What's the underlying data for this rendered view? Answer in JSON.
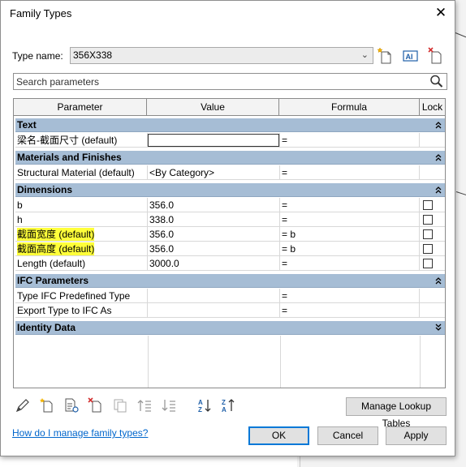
{
  "window": {
    "title": "Family Types",
    "close_symbol": "✕"
  },
  "type_name": {
    "label": "Type name:",
    "value": "356X338"
  },
  "search": {
    "placeholder": "Search parameters"
  },
  "grid": {
    "columns": [
      "Parameter",
      "Value",
      "Formula",
      "Lock"
    ],
    "groups": [
      {
        "label": "Text",
        "rows": [
          {
            "param": "梁名-截面尺寸 (default)",
            "value": "",
            "formula": "=",
            "lock": false,
            "editing": true
          }
        ]
      },
      {
        "label": "Materials and Finishes",
        "rows": [
          {
            "param": "Structural Material (default)",
            "value": "<By Category>",
            "formula": "=",
            "lock": false
          }
        ]
      },
      {
        "label": "Dimensions",
        "rows": [
          {
            "param": "b",
            "value": "356.0",
            "formula": "=",
            "lock": false,
            "lockbox": true
          },
          {
            "param": "h",
            "value": "338.0",
            "formula": "=",
            "lock": false,
            "lockbox": true
          },
          {
            "param": "截面宽度 (default)",
            "value": "356.0",
            "formula": "= b",
            "lock": false,
            "lockbox": true,
            "highlight": true
          },
          {
            "param": "截面高度 (default)",
            "value": "356.0",
            "formula": "= b",
            "lock": false,
            "lockbox": true,
            "highlight": true
          },
          {
            "param": "Length (default)",
            "value": "3000.0",
            "formula": "=",
            "lock": false,
            "lockbox": true
          }
        ]
      },
      {
        "label": "IFC Parameters",
        "rows": [
          {
            "param": "Type IFC Predefined Type",
            "value": "",
            "formula": "=",
            "lock": false
          },
          {
            "param": "Export Type to IFC As",
            "value": "",
            "formula": "=",
            "lock": false
          }
        ]
      },
      {
        "label": "Identity Data",
        "collapsed": true,
        "rows": []
      }
    ]
  },
  "buttons": {
    "manage_lookup": "Manage Lookup Tables",
    "ok": "OK",
    "cancel": "Cancel",
    "apply": "Apply"
  },
  "help_link": "How do I manage family types?",
  "colors": {
    "group_header": "#a6bdd5",
    "highlight": "#ffff3a",
    "link": "#0066cc",
    "ok_border": "#0078d7"
  }
}
